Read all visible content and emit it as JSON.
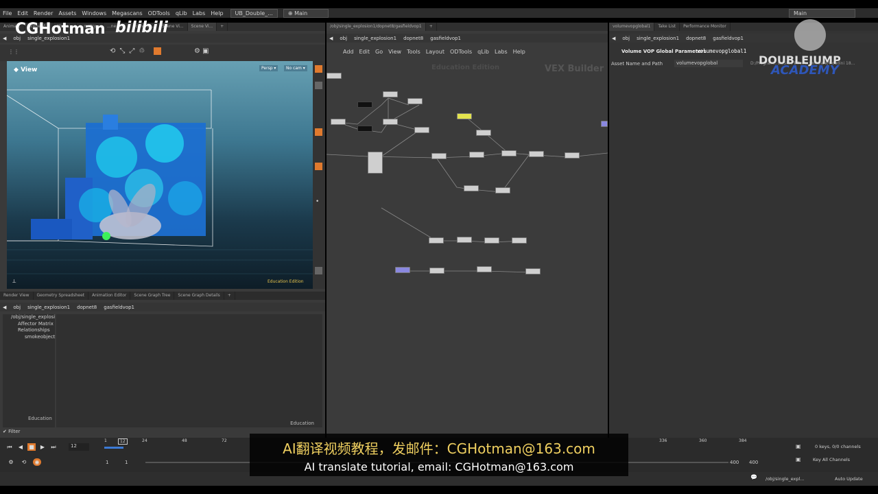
{
  "menubar": {
    "items": [
      "File",
      "Edit",
      "Render",
      "Assets",
      "Windows",
      "Megascans",
      "ODTools",
      "qLib",
      "Labs",
      "Help"
    ],
    "desktop_tab": "UB_Double_...",
    "desk_select": "Main",
    "right_select": "Main"
  },
  "watermark": {
    "left": "CGHotman",
    "bili": "bilibili",
    "brand1": "DOUBLEJUMP",
    "brand2": "ACADEMY"
  },
  "left_top": {
    "tabs": [
      "Anima...",
      "Scene Vi...",
      "Motio...",
      "...metry...",
      "...ne Vi...",
      "Scene Vi...",
      "Scene Vi...",
      "Scene Vi..."
    ],
    "path": [
      "obj",
      "single_explosion1"
    ],
    "viewport_title": "View",
    "persp": "Persp ▾",
    "cam": "No cam ▾",
    "edition": "Education Edition"
  },
  "left_bottom": {
    "tabs": [
      "Render View",
      "Geometry Spreadsheet",
      "Animation Editor",
      "Scene Graph Tree",
      "Scene Graph Details"
    ],
    "path": [
      "obj",
      "single_explosion1",
      "dopnet8",
      "gasfieldvop1"
    ],
    "tree": [
      "/obj/single_explosi",
      "Affector Matrix",
      "Relationships",
      "smokeobject"
    ],
    "education1": "Education",
    "education2": "Education",
    "filter": "Filter"
  },
  "network": {
    "tab": "/obj/single_explosion1/dopnet8/gasfieldvop1",
    "path": [
      "obj",
      "single_explosion1",
      "dopnet8",
      "gasfieldvop1"
    ],
    "menu": [
      "Add",
      "Edit",
      "Go",
      "View",
      "Tools",
      "Layout",
      "ODTools",
      "qLib",
      "Labs",
      "Help"
    ],
    "watermark": "Education Edition",
    "context": "VEX Builder"
  },
  "params": {
    "tabs": [
      "volumevopglobal1",
      "Take List",
      "Performance Monitor"
    ],
    "path": [
      "obj",
      "single_explosion1",
      "dopnet8",
      "gasfieldvop1"
    ],
    "title": "Volume VOP Global Parameters",
    "node_name": "volumevopglobal1",
    "asset_label": "Asset Name and Path",
    "asset_value": "volumevopglobal",
    "asset_path": "D:/Program...se/Side Effects Software/Houdini 18..."
  },
  "timeline": {
    "frame": "12",
    "ticks": [
      "1",
      "12",
      "24",
      "48",
      "72",
      "336",
      "360",
      "384"
    ],
    "start": "1",
    "start2": "1",
    "end1": "400",
    "end2": "400",
    "keys": "0 keys, 0/0 channels",
    "key_all": "Key All Channels",
    "status_path": "/obj/single_expl...",
    "auto_update": "Auto Update"
  },
  "subtitles": {
    "line1": "AI翻译视频教程，发邮件：CGHotman@163.com",
    "line2": "AI translate tutorial, email: CGHotman@163.com"
  },
  "colors": {
    "accent": "#e07a2e",
    "viewport_bg": "#2f5f7a",
    "node_yellow": "#e3e34e",
    "node_purple": "#8a88e0"
  }
}
